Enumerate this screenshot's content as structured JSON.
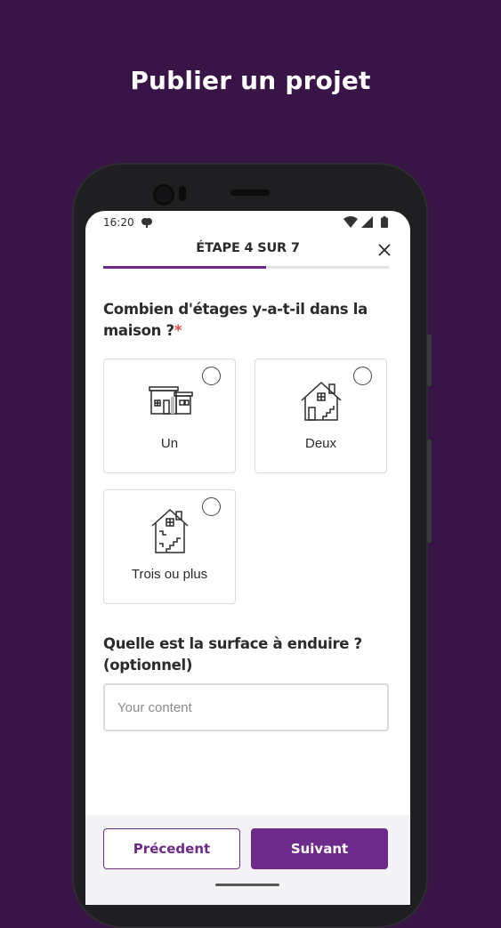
{
  "promo": {
    "headline": "Publier un projet"
  },
  "status_bar": {
    "time": "16:20"
  },
  "header": {
    "step_label": "ÉTAPE 4 SUR 7",
    "progress_fraction": 0.571
  },
  "question_floors": {
    "text": "Combien d'étages y-a-t-il dans la maison ?",
    "required_mark": "*",
    "options": [
      {
        "label": "Un",
        "icon": "single-story-house-icon",
        "selected": false
      },
      {
        "label": "Deux",
        "icon": "two-story-house-icon",
        "selected": false
      },
      {
        "label": "Trois ou plus",
        "icon": "three-story-house-icon",
        "selected": false
      }
    ]
  },
  "question_surface": {
    "text": "Quelle est la surface à enduire ? (optionnel)",
    "placeholder": "Your content",
    "value": ""
  },
  "footer": {
    "prev_label": "Précedent",
    "next_label": "Suivant"
  },
  "colors": {
    "background": "#381447",
    "accent": "#6e2a8a",
    "required": "#e04a4a"
  }
}
